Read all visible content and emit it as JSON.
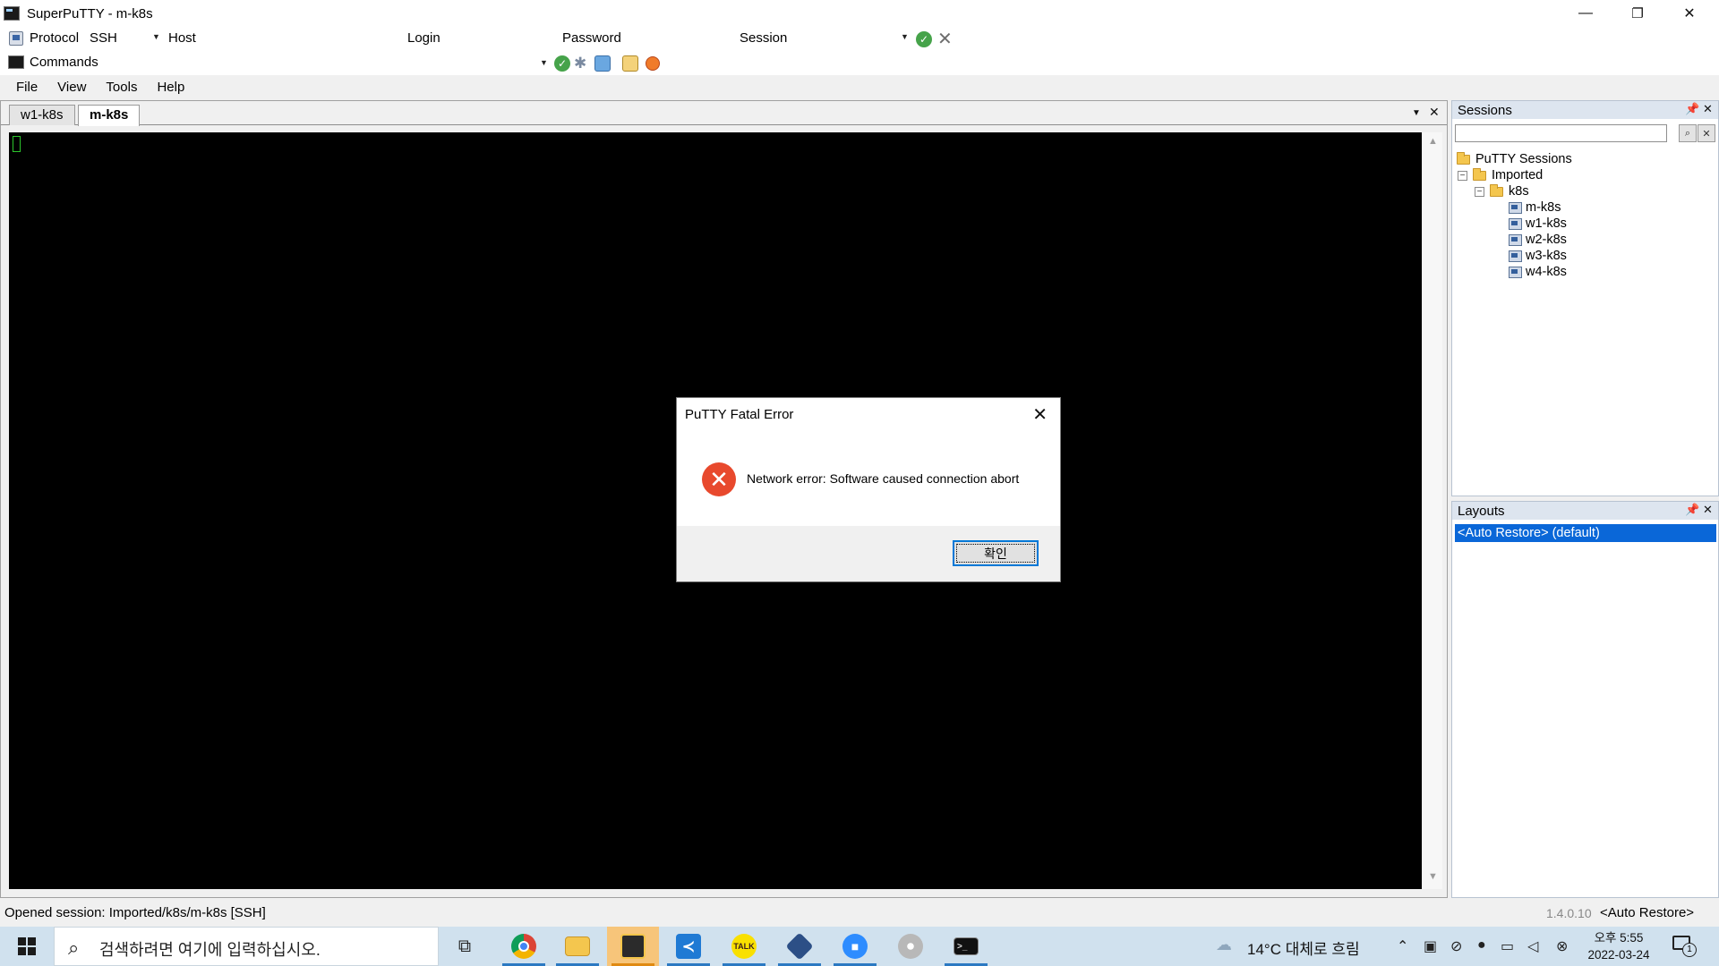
{
  "window": {
    "title": "SuperPuTTY - m-k8s",
    "minimize": "—",
    "restore": "❐",
    "close": "✕"
  },
  "connection_toolbar": {
    "protocol_label": "Protocol",
    "protocol_value": "SSH",
    "host_label": "Host",
    "login_label": "Login",
    "password_label": "Password",
    "session_label": "Session"
  },
  "commands_toolbar": {
    "commands_label": "Commands"
  },
  "menu": {
    "file": "File",
    "view": "View",
    "tools": "Tools",
    "help": "Help"
  },
  "tabs": [
    {
      "label": "w1-k8s"
    },
    {
      "label": "m-k8s"
    }
  ],
  "sessions_panel": {
    "title": "Sessions",
    "tree": {
      "root": "PuTTY Sessions",
      "imported": "Imported",
      "k8s": "k8s",
      "sessions": [
        "m-k8s",
        "w1-k8s",
        "w2-k8s",
        "w3-k8s",
        "w4-k8s"
      ]
    }
  },
  "layouts_panel": {
    "title": "Layouts",
    "selected": "<Auto Restore> (default)"
  },
  "status": {
    "message": "Opened session: Imported/k8s/m-k8s [SSH]",
    "version": "1.4.0.10",
    "layout": "<Auto Restore>"
  },
  "dialog": {
    "title": "PuTTY Fatal Error",
    "message": "Network error: Software caused connection abort",
    "ok_label": "확인"
  },
  "taskbar": {
    "search_placeholder": "검색하려면 여기에 입력하십시오.",
    "weather": "14°C 대체로 흐림",
    "time": "오후 5:55",
    "date": "2022-03-24",
    "notification_count": "1"
  },
  "colors": {
    "selection": "#0a67d8",
    "error_icon": "#e8492d",
    "ok_green": "#46a34a",
    "taskbar": "#d0e1ee"
  }
}
